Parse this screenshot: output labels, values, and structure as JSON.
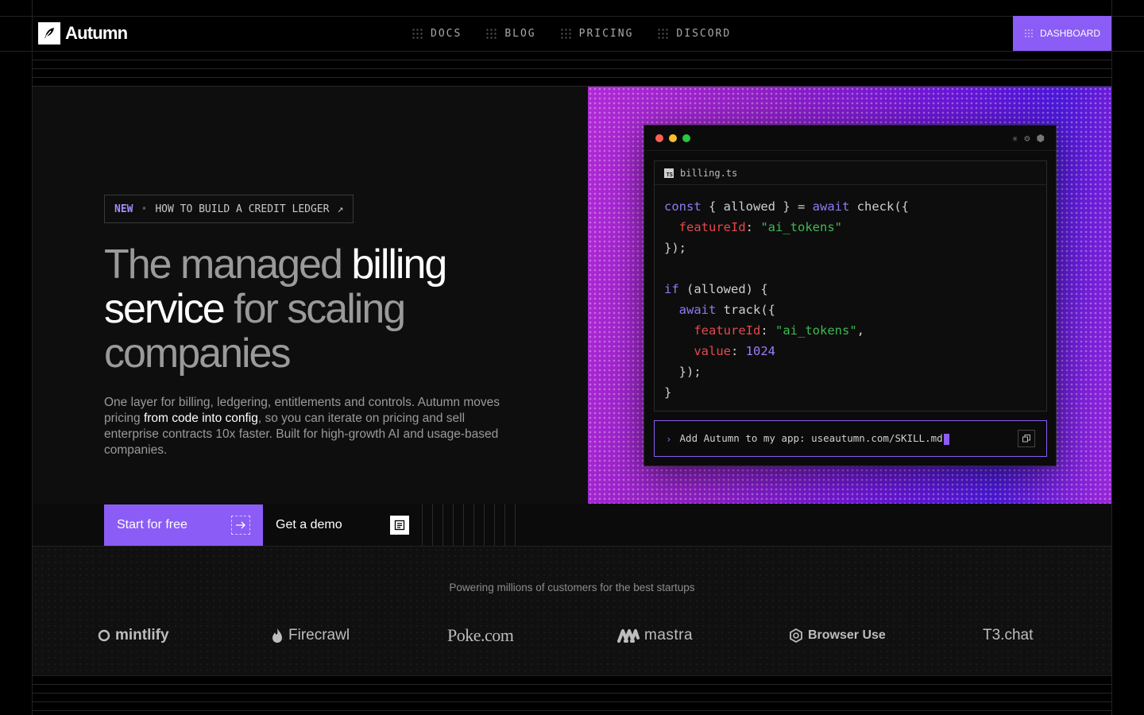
{
  "brand": {
    "name": "Autumn"
  },
  "nav": {
    "links": [
      "DOCS",
      "BLOG",
      "PRICING",
      "DISCORD"
    ],
    "dashboard": "DASHBOARD"
  },
  "hero": {
    "badge": {
      "tag": "NEW",
      "sep": "•",
      "text": "HOW TO BUILD A CREDIT LEDGER",
      "arrow": "↗"
    },
    "headline": {
      "p1": "The managed ",
      "h1": "billing",
      "h2": "service",
      "p2": " for scaling companies"
    },
    "description": {
      "p1": "One layer for billing, ledgering, entitlements and controls. Autumn moves pricing ",
      "h1": "from code into config",
      "p2": ", so you can iterate on pricing and sell enterprise contracts 10x faster. Built for high-growth AI and usage-based companies."
    },
    "cta_primary": "Start for free",
    "cta_secondary": "Get a demo"
  },
  "editor": {
    "filename": "billing.ts",
    "file_icon_label": "TS",
    "window_icons": [
      "✳",
      "⚙",
      "⬢"
    ],
    "code": {
      "l1": {
        "kw1": "const",
        "mid": " { allowed } = ",
        "kw2": "await",
        "end": " check({"
      },
      "l2": {
        "prop": "featureId",
        "colon": ": ",
        "str": "\"ai_tokens\""
      },
      "l3": "});",
      "l5": {
        "kw": "if",
        "end": " (allowed) {"
      },
      "l6": {
        "kw": "await",
        "end": " track({"
      },
      "l7": {
        "prop": "featureId",
        "colon": ": ",
        "str": "\"ai_tokens\"",
        "end": ","
      },
      "l8": {
        "prop": "value",
        "colon": ": ",
        "num": "1024"
      },
      "l9": "});",
      "l10": "}"
    },
    "prompt": {
      "chevron": "›",
      "text": "Add Autumn to my app: useautumn.com/SKILL.md"
    }
  },
  "customers": {
    "title": "Powering millions of customers for the best startups",
    "logos": [
      "mintlify",
      "Firecrawl",
      "Poke.com",
      "mastra",
      "Browser Use",
      "T3.chat"
    ]
  },
  "colors": {
    "accent": "#8b5cf6",
    "background": "#000000",
    "panel": "#0e0e0e"
  }
}
